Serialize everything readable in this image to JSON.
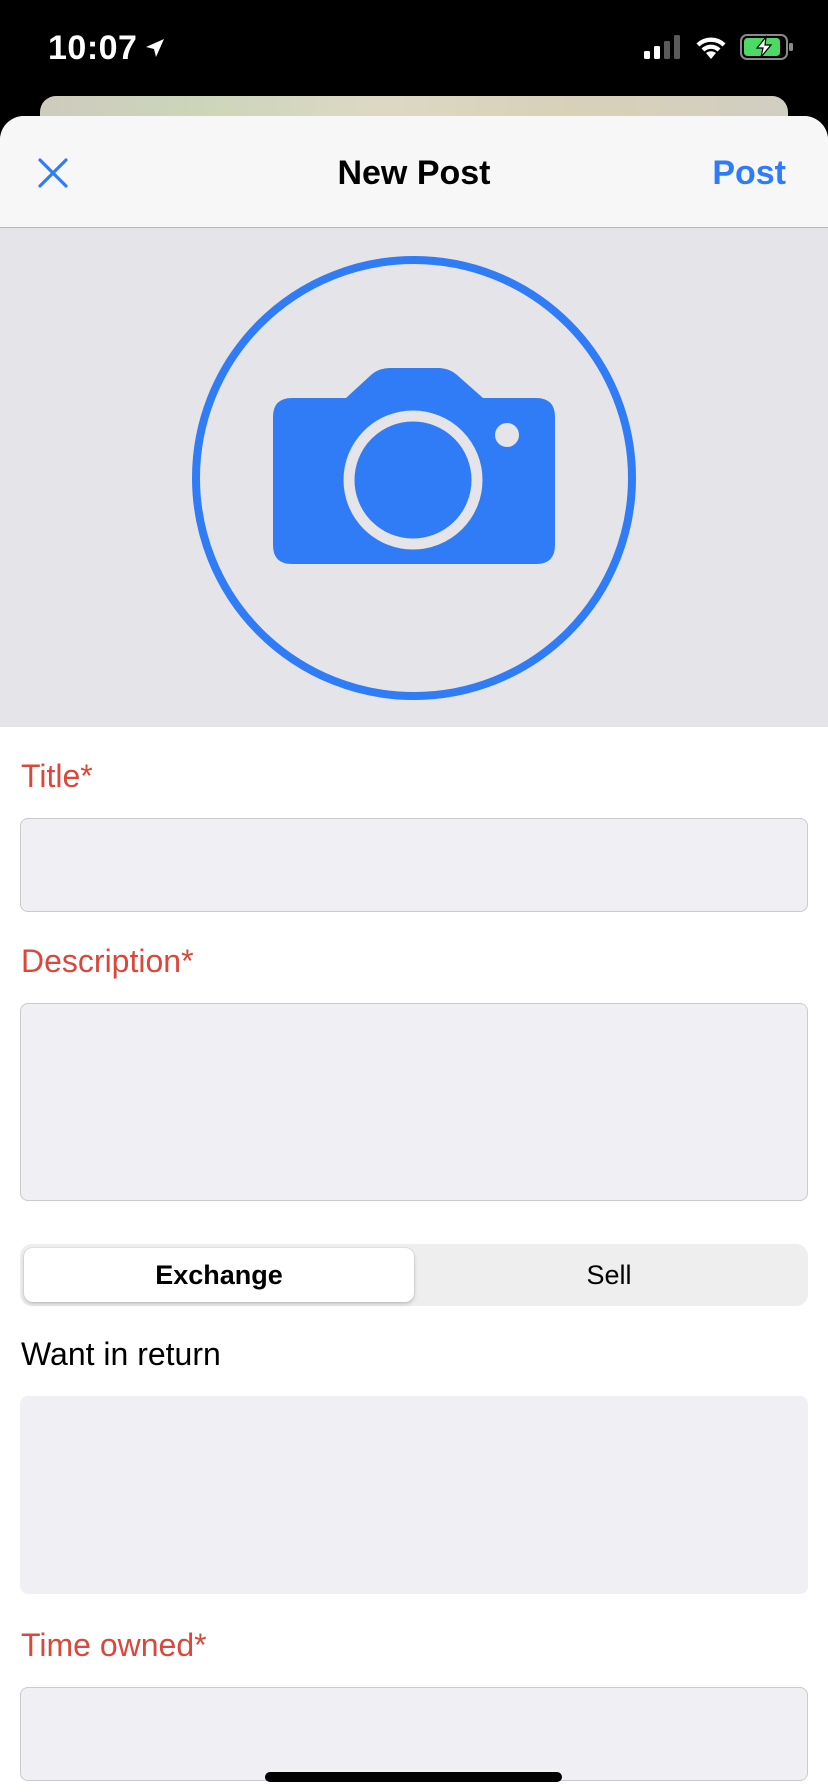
{
  "status_bar": {
    "time": "10:07"
  },
  "nav": {
    "title": "New Post",
    "post_label": "Post"
  },
  "colors": {
    "accent": "#2f7cf6",
    "required_label": "#d9483b",
    "photo_bg": "#e4e4e9",
    "field_bg": "#efeff4"
  },
  "photo": {
    "icon": "camera-icon"
  },
  "form": {
    "title_label": "Title*",
    "title_value": "",
    "description_label": "Description*",
    "description_value": "",
    "mode_segments": [
      "Exchange",
      "Sell"
    ],
    "mode_selected": "Exchange",
    "want_label": "Want in return",
    "want_value": "",
    "time_owned_label": "Time owned*",
    "time_owned_value": ""
  }
}
